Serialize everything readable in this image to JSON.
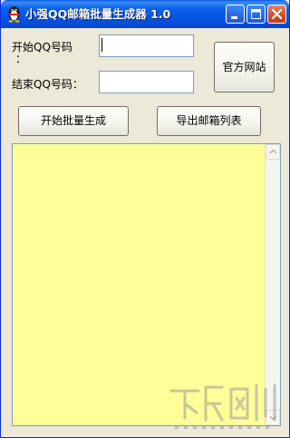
{
  "window": {
    "title": "小强QQ邮箱批量生成器 1.0",
    "title_icon": "qq-penguin-icon",
    "controls": {
      "minimize_icon": "minimize-icon",
      "maximize_icon": "maximize-icon",
      "close_icon": "close-icon"
    }
  },
  "form": {
    "start_label": "开始QQ号码",
    "start_label_colon": "：",
    "start_value": "",
    "end_label": "结束QQ号码：",
    "end_value": ""
  },
  "buttons": {
    "official_site": "官方网站",
    "batch_generate": "开始批量生成",
    "export_list": "导出邮箱列表"
  },
  "output": {
    "text": "",
    "background_color": "#ffff99"
  },
  "watermark": {
    "icon": "download-site-watermark-icon"
  },
  "colors": {
    "titlebar": "#0552df",
    "window_face": "#ece9d8",
    "close_button": "#d6532e"
  }
}
